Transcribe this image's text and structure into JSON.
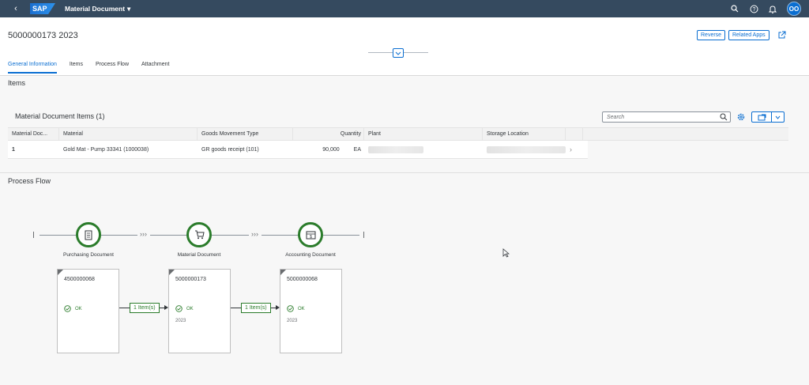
{
  "shell": {
    "logo": "SAP",
    "app_title": "Material Document",
    "icons": [
      "search-icon",
      "help-icon",
      "bell-icon"
    ],
    "avatar": "OO"
  },
  "header": {
    "title": "5000000173 2023",
    "reverse_label": "Reverse",
    "related_apps_label": "Related Apps",
    "tabs": [
      {
        "label": "General Information",
        "active": true
      },
      {
        "label": "Items",
        "active": false
      },
      {
        "label": "Process Flow",
        "active": false
      },
      {
        "label": "Attachment",
        "active": false
      }
    ]
  },
  "items_section": {
    "title": "Items",
    "table_title": "Material Document Items (1)",
    "search_placeholder": "Search",
    "columns": [
      "Material Doc...",
      "Material",
      "Goods Movement Type",
      "Quantity",
      "Plant",
      "Storage Location"
    ],
    "rows": [
      {
        "item": "1",
        "material": "Gold Mat - Pump 33341 (1000038)",
        "movement_type": "GR goods receipt (101)",
        "quantity": "90,000",
        "unit": "EA"
      }
    ]
  },
  "process_flow": {
    "title": "Process Flow",
    "lanes": [
      {
        "label": "Purchasing Document",
        "icon": "document-icon"
      },
      {
        "label": "Material Document",
        "icon": "cart-icon"
      },
      {
        "label": "Accounting Document",
        "icon": "accounting-icon"
      }
    ],
    "documents": [
      {
        "number": "4500000068",
        "status": "OK",
        "year": ""
      },
      {
        "number": "5000000173",
        "status": "OK",
        "year": "2023"
      },
      {
        "number": "5000000068",
        "status": "OK",
        "year": "2023"
      }
    ],
    "connections": [
      "1 Item(s)",
      "1 Item(s)"
    ]
  },
  "colors": {
    "shell": "#354a5f",
    "accent": "#0a6ed1",
    "success": "#2b7c2b"
  }
}
